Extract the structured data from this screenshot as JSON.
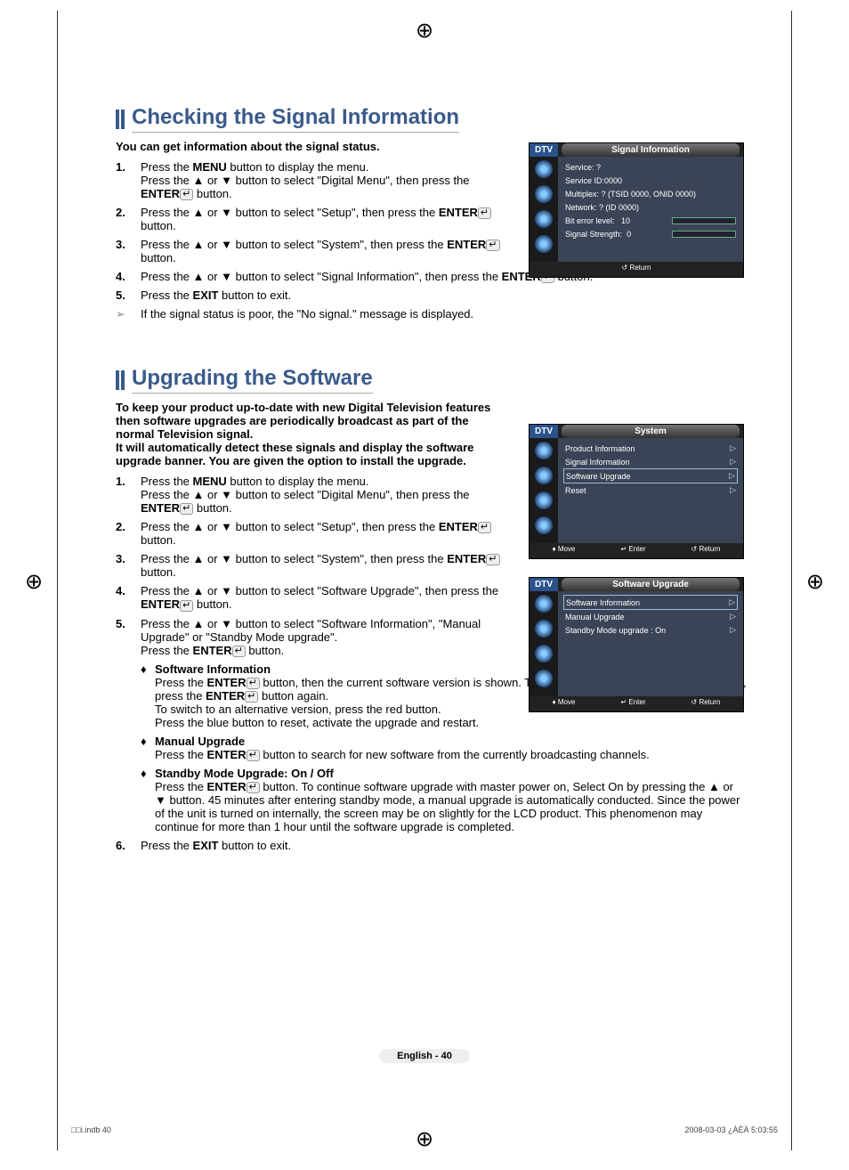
{
  "sec1": {
    "title": "Checking the Signal Information",
    "intro": "You can get information about the signal status.",
    "steps": [
      "Press the <b>MENU</b> button to display the menu.<br>Press the ▲ or ▼ button to select \"Digital Menu\", then press the <b>ENTER</b><span class=enter-icon>↵</span> button.",
      "Press the ▲ or ▼ button to select \"Setup\", then press the <b>ENTER</b><span class=enter-icon>↵</span> button.",
      "Press the ▲ or ▼ button to select \"System\", then press the <b>ENTER</b><span class=enter-icon>↵</span> button.",
      "Press the ▲ or ▼ button to select \"Signal Information\", then press the <b>ENTER</b><span class=enter-icon>↵</span> button.",
      "Press the <b>EXIT</b> button to exit."
    ],
    "note": "If the signal status is poor, the \"No signal.\" message is displayed."
  },
  "sec2": {
    "title": "Upgrading the Software",
    "intro": "To keep your product up-to-date with new Digital Television features then software upgrades are periodically broadcast as part of the normal Television signal.<br>It will automatically detect these signals and display the software upgrade banner. You are given the option to install the upgrade.",
    "steps": [
      "Press the <b>MENU</b> button to display the menu.<br>Press the ▲ or ▼ button to select \"Digital Menu\", then press the <b>ENTER</b><span class=enter-icon>↵</span> button.",
      "Press the ▲ or ▼ button to select \"Setup\", then press the <b>ENTER</b><span class=enter-icon>↵</span> button.",
      "Press the ▲ or ▼ button to select \"System\", then press the <b>ENTER</b><span class=enter-icon>↵</span> button.",
      "Press the ▲ or ▼ button to select \"Software Upgrade\", then press the <b>ENTER</b><span class=enter-icon>↵</span> button.",
      "Press the ▲ or ▼ button to select \"Software Information\", \"Manual Upgrade\" or \"Standby Mode upgrade\".<br>Press the <b>ENTER</b><span class=enter-icon>↵</span> button."
    ],
    "subs": [
      {
        "h": "Software Information",
        "b": "Press the <b>ENTER</b><span class=enter-icon>↵</span> button, then the current software version is shown. To display the software version information, press the <b>ENTER</b><span class=enter-icon>↵</span> button again.<br>To switch to an alternative version, press the red button.<br>Press the blue button to reset, activate the upgrade and restart."
      },
      {
        "h": "Manual Upgrade",
        "b": "Press the <b>ENTER</b><span class=enter-icon>↵</span> button to search for new software from the currently broadcasting channels."
      },
      {
        "h": "Standby Mode Upgrade: On / Off",
        "b": "Press the <b>ENTER</b><span class=enter-icon>↵</span> button. To continue software upgrade with master power on, Select On by pressing the ▲ or ▼ button. 45 minutes after entering standby mode, a manual upgrade is automatically conducted. Since the power of the unit is turned on internally, the screen may be on slightly for the LCD product. This phenomenon may continue for more than 1 hour until the software upgrade is completed."
      }
    ],
    "step6": "Press the <b>EXIT</b> button to exit."
  },
  "osd1": {
    "dtv": "DTV",
    "title": "Signal Information",
    "lines": [
      "Service: ?",
      "Service ID:0000",
      "Multiplex: ? (TSID 0000, ONID 0000)",
      "Network: ? (ID 0000)"
    ],
    "bit": "Bit error level:",
    "bitv": "10",
    "sig": "Signal Strength:",
    "sigv": "0",
    "ret": "↺ Return"
  },
  "osd2": {
    "dtv": "DTV",
    "title": "System",
    "items": [
      "Product Information",
      "Signal Information",
      "Software Upgrade",
      "Reset"
    ],
    "sel": 2,
    "move": "♦ Move",
    "enter": "↵ Enter",
    "ret": "↺ Return"
  },
  "osd3": {
    "dtv": "DTV",
    "title": "Software Upgrade",
    "items": [
      "Software Information",
      "Manual Upgrade",
      "Standby Mode upgrade : On"
    ],
    "sel": 0,
    "move": "♦ Move",
    "enter": "↵ Enter",
    "ret": "↺ Return"
  },
  "page": "English - 40",
  "indb": "□□i.indb   40",
  "date": "2008-03-03   ¿ÀÈÄ 5:03:55"
}
